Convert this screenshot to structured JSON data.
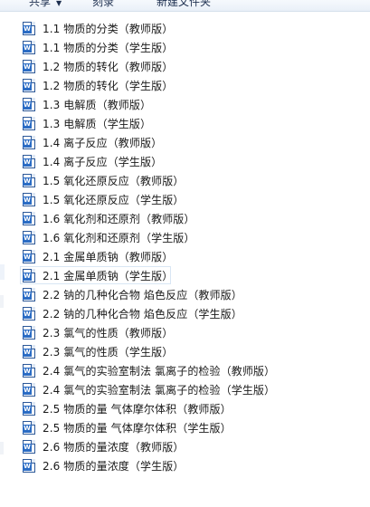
{
  "toolbar": {
    "share_label": "共享",
    "share_caret": "▼",
    "burn_label": "刻录",
    "newfolder_label": "新建文件夹"
  },
  "files": [
    {
      "name": "1.1 物质的分类（教师版）",
      "icon": "word-doc-icon"
    },
    {
      "name": "1.1 物质的分类（学生版）",
      "icon": "word-doc-icon"
    },
    {
      "name": "1.2 物质的转化（教师版）",
      "icon": "word-doc-icon"
    },
    {
      "name": "1.2 物质的转化（学生版）",
      "icon": "word-doc-icon"
    },
    {
      "name": "1.3 电解质（教师版）",
      "icon": "word-doc-icon"
    },
    {
      "name": "1.3 电解质（学生版）",
      "icon": "word-doc-icon"
    },
    {
      "name": "1.4 离子反应（教师版）",
      "icon": "word-doc-icon"
    },
    {
      "name": "1.4 离子反应（学生版）",
      "icon": "word-doc-icon"
    },
    {
      "name": "1.5 氧化还原反应（教师版）",
      "icon": "word-doc-icon"
    },
    {
      "name": "1.5 氧化还原反应（学生版）",
      "icon": "word-doc-icon"
    },
    {
      "name": "1.6 氧化剂和还原剂（教师版）",
      "icon": "word-doc-icon"
    },
    {
      "name": "1.6 氧化剂和还原剂（学生版）",
      "icon": "word-doc-icon"
    },
    {
      "name": "2.1 金属单质钠（教师版）",
      "icon": "word-doc-icon"
    },
    {
      "name": "2.1 金属单质钠（学生版）",
      "icon": "word-doc-icon",
      "selected": true
    },
    {
      "name": "2.2 钠的几种化合物  焰色反应（教师版）",
      "icon": "word-doc-icon"
    },
    {
      "name": "2.2 钠的几种化合物  焰色反应（学生版）",
      "icon": "word-doc-icon"
    },
    {
      "name": "2.3 氯气的性质（教师版）",
      "icon": "word-doc-icon"
    },
    {
      "name": "2.3 氯气的性质（学生版）",
      "icon": "word-doc-icon"
    },
    {
      "name": "2.4 氯气的实验室制法 氯离子的检验（教师版）",
      "icon": "word-doc-icon"
    },
    {
      "name": "2.4 氯气的实验室制法 氯离子的检验（学生版）",
      "icon": "word-doc-icon"
    },
    {
      "name": "2.5 物质的量  气体摩尔体积（教师版）",
      "icon": "word-doc-icon"
    },
    {
      "name": "2.5 物质的量  气体摩尔体积（学生版）",
      "icon": "word-doc-icon"
    },
    {
      "name": "2.6 物质的量浓度（教师版）",
      "icon": "word-doc-icon"
    },
    {
      "name": "2.6 物质的量浓度（学生版）",
      "icon": "word-doc-icon"
    }
  ],
  "icon_badge_letter": "W",
  "colors": {
    "word_blue": "#2b6cc4",
    "toolbar_bg": "#eef3f9",
    "selection_border": "#d8e6f4",
    "text": "#1a1a1a"
  }
}
